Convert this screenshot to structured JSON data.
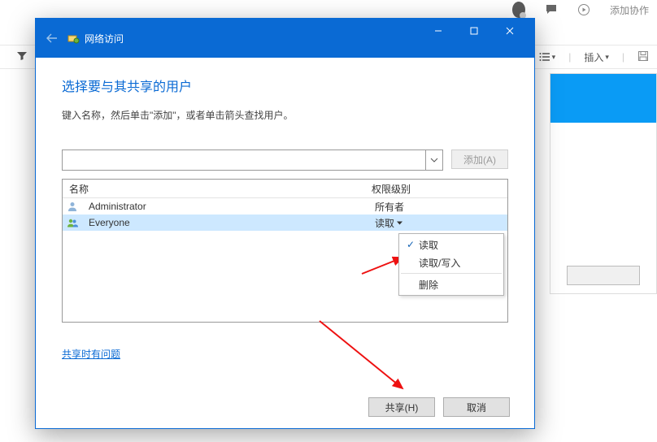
{
  "bg": {
    "add_collab": "添加协作",
    "insert": "插入",
    "line_spacing_icon": "line-spacing",
    "list_icon": "list"
  },
  "dialog": {
    "title": "网络访问",
    "heading": "选择要与其共享的用户",
    "instruction": "键入名称，然后单击\"添加\"，或者单击箭头查找用户。",
    "add_btn": "添加(A)",
    "columns": {
      "name": "名称",
      "perm": "权限级别"
    },
    "rows": [
      {
        "name": "Administrator",
        "perm": "所有者",
        "selected": false
      },
      {
        "name": "Everyone",
        "perm": "读取",
        "selected": true
      }
    ],
    "menu": {
      "items": [
        {
          "label": "读取",
          "checked": true
        },
        {
          "label": "读取/写入",
          "checked": false
        }
      ],
      "delete": "删除"
    },
    "help_link": "共享时有问题",
    "share_btn": "共享(H)",
    "cancel_btn": "取消"
  }
}
